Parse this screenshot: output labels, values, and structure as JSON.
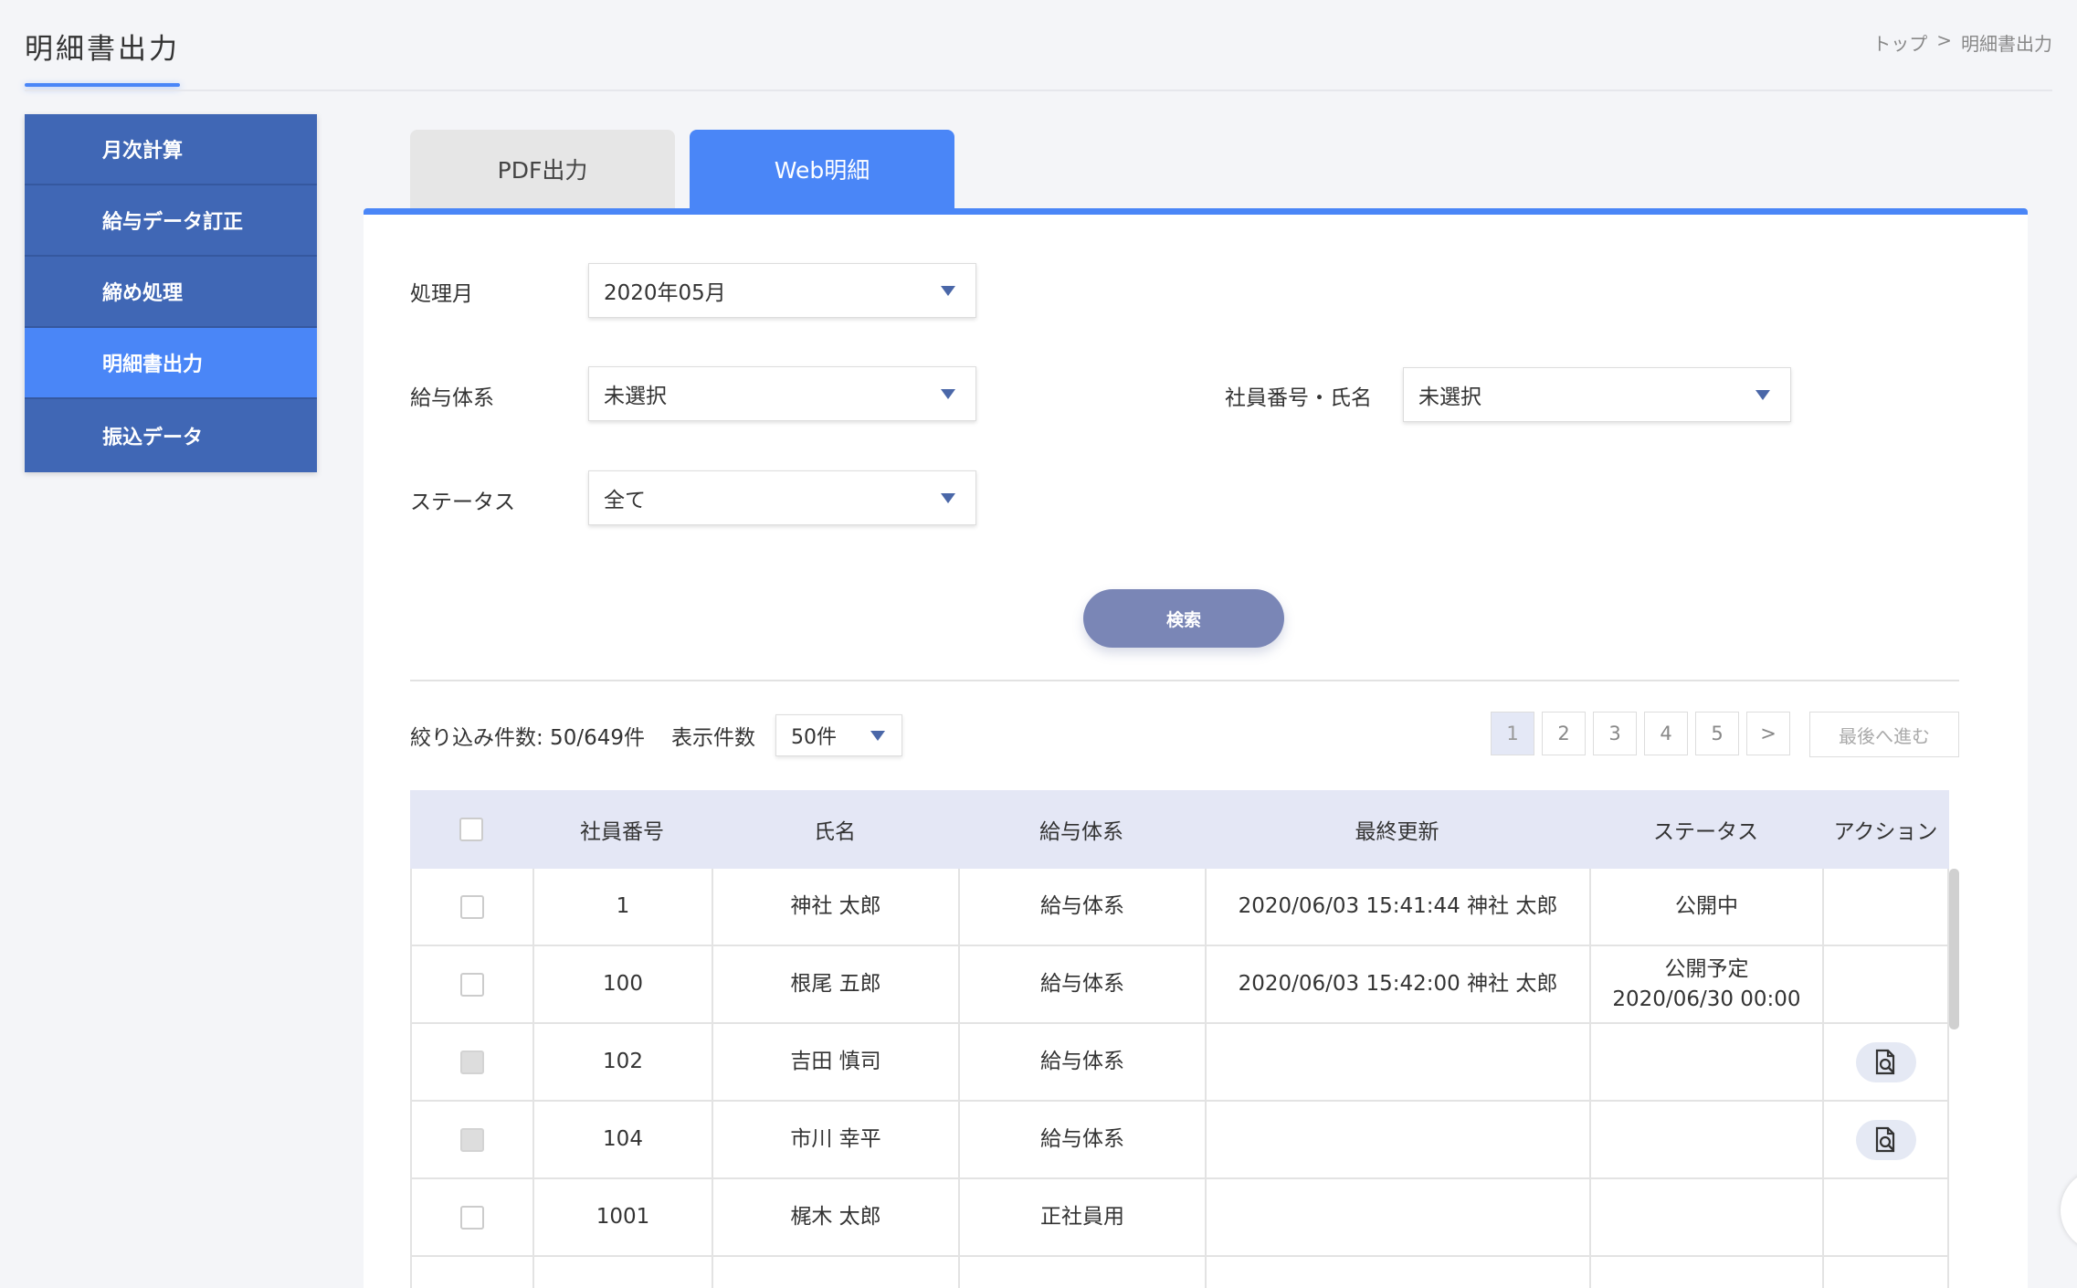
{
  "page": {
    "title": "明細書出力",
    "breadcrumb": [
      "トップ",
      ">",
      "明細書出力"
    ]
  },
  "sidebar": {
    "items": [
      {
        "label": "月次計算",
        "active": false
      },
      {
        "label": "給与データ訂正",
        "active": false
      },
      {
        "label": "締め処理",
        "active": false
      },
      {
        "label": "明細書出力",
        "active": true
      },
      {
        "label": "振込データ",
        "active": false
      }
    ]
  },
  "tabs": [
    {
      "label": "PDF出力",
      "active": false
    },
    {
      "label": "Web明細",
      "active": true
    }
  ],
  "form": {
    "month_label": "処理月",
    "month_value": "2020年05月",
    "salary_label": "給与体系",
    "salary_value": "未選択",
    "employee_label": "社員番号・氏名",
    "employee_value": "未選択",
    "status_label": "ステータス",
    "status_value": "全て",
    "search_label": "検索"
  },
  "results": {
    "count_text": "絞り込み件数: 50/649件",
    "perpage_label": "表示件数",
    "perpage_value": "50件",
    "pages": [
      "1",
      "2",
      "3",
      "4",
      "5",
      ">"
    ],
    "current_page": "1",
    "last_label": "最後へ進む"
  },
  "table": {
    "headers": [
      "社員番号",
      "氏名",
      "給与体系",
      "最終更新",
      "ステータス",
      "アクション"
    ],
    "rows": [
      {
        "id": "1",
        "name": "神社 太郎",
        "system": "給与体系",
        "updated": "2020/06/03 15:41:44 神社 太郎",
        "status": "公開中",
        "status2": "",
        "action": false,
        "checkbox_disabled": false
      },
      {
        "id": "100",
        "name": "根尾 五郎",
        "system": "給与体系",
        "updated": "2020/06/03 15:42:00 神社 太郎",
        "status": "公開予定",
        "status2": "2020/06/30 00:00",
        "action": false,
        "checkbox_disabled": false
      },
      {
        "id": "102",
        "name": "吉田 慎司",
        "system": "給与体系",
        "updated": "",
        "status": "",
        "status2": "",
        "action": true,
        "checkbox_disabled": true
      },
      {
        "id": "104",
        "name": "市川 幸平",
        "system": "給与体系",
        "updated": "",
        "status": "",
        "status2": "",
        "action": true,
        "checkbox_disabled": true
      },
      {
        "id": "1001",
        "name": "梶木 太郎",
        "system": "正社員用",
        "updated": "",
        "status": "",
        "status2": "",
        "action": false,
        "checkbox_disabled": false
      }
    ]
  },
  "icons": {
    "dropdown": "chevron-down-icon",
    "preview": "document-search-icon"
  },
  "colors": {
    "accent": "#4a86f7",
    "sidebar": "#4067b5",
    "search_button": "#7a86b6",
    "table_header": "#e4e7f5"
  }
}
